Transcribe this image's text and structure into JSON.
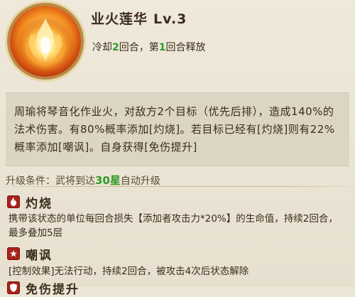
{
  "skill": {
    "name": "业火莲华",
    "level": "Lv.3",
    "icon": "flame-lotus-icon",
    "cooldown_prefix": "冷却",
    "cooldown_value": "2",
    "cooldown_mid": "回合，第",
    "release_value": "1",
    "release_suffix": "回合释放"
  },
  "description": "周瑜将琴音化作业火，对敌方2个目标（优先后排），造成140%的法术伤害。有80%概率添加[灼烧]。若目标已经有[灼烧]则有22%概率添加[嘲讽]。自身获得[免伤提升]",
  "upgrade": {
    "prefix": "升级条件：武将到达",
    "star": "30星",
    "suffix": "自动升级"
  },
  "effects": [
    {
      "name": "灼烧",
      "icon": "fire-icon",
      "desc": "携带该状态的单位每回合损失【添加者攻击力*20%】的生命值，持续2回合，最多叠加5层"
    },
    {
      "name": "嘲讽",
      "icon": "taunt-icon",
      "desc": "[控制效果]无法行动，持续2回合，被攻击4次后状态解除"
    },
    {
      "name": "免伤提升",
      "icon": "shield-icon",
      "desc": ""
    }
  ],
  "colors": {
    "highlight_green": "#2e9a26",
    "effect_icon_red": "#a8231b",
    "background": "#ece6d7"
  }
}
